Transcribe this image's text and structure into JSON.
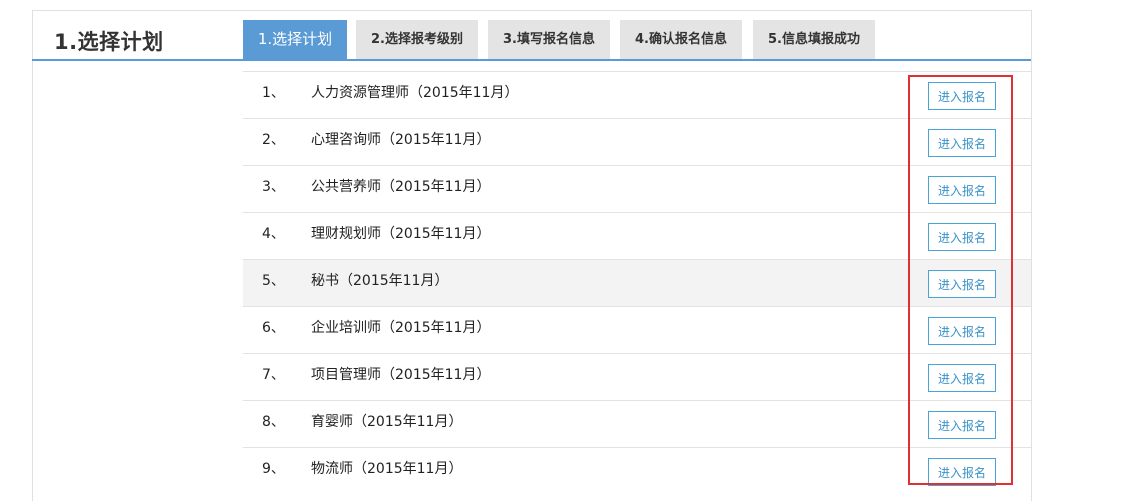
{
  "header": {
    "title": "1.选择计划"
  },
  "steps": [
    {
      "label": "1.选择计划",
      "active": true
    },
    {
      "label": "2.选择报考级别",
      "active": false
    },
    {
      "label": "3.填写报名信息",
      "active": false
    },
    {
      "label": "4.确认报名信息",
      "active": false
    },
    {
      "label": "5.信息填报成功",
      "active": false
    }
  ],
  "plans": [
    {
      "num": "1、",
      "name": "人力资源管理师（2015年11月）",
      "button": "进入报名"
    },
    {
      "num": "2、",
      "name": "心理咨询师（2015年11月）",
      "button": "进入报名"
    },
    {
      "num": "3、",
      "name": "公共营养师（2015年11月）",
      "button": "进入报名"
    },
    {
      "num": "4、",
      "name": "理财规划师（2015年11月）",
      "button": "进入报名"
    },
    {
      "num": "5、",
      "name": "秘书（2015年11月）",
      "button": "进入报名"
    },
    {
      "num": "6、",
      "name": "企业培训师（2015年11月）",
      "button": "进入报名"
    },
    {
      "num": "7、",
      "name": "项目管理师（2015年11月）",
      "button": "进入报名"
    },
    {
      "num": "8、",
      "name": "育婴师（2015年11月）",
      "button": "进入报名"
    },
    {
      "num": "9、",
      "name": "物流师（2015年11月）",
      "button": "进入报名"
    }
  ],
  "colors": {
    "accent": "#5b9bd5",
    "tab_inactive": "#e4e4e4",
    "button_border": "#4aa3d6",
    "highlight": "#e0312f"
  }
}
